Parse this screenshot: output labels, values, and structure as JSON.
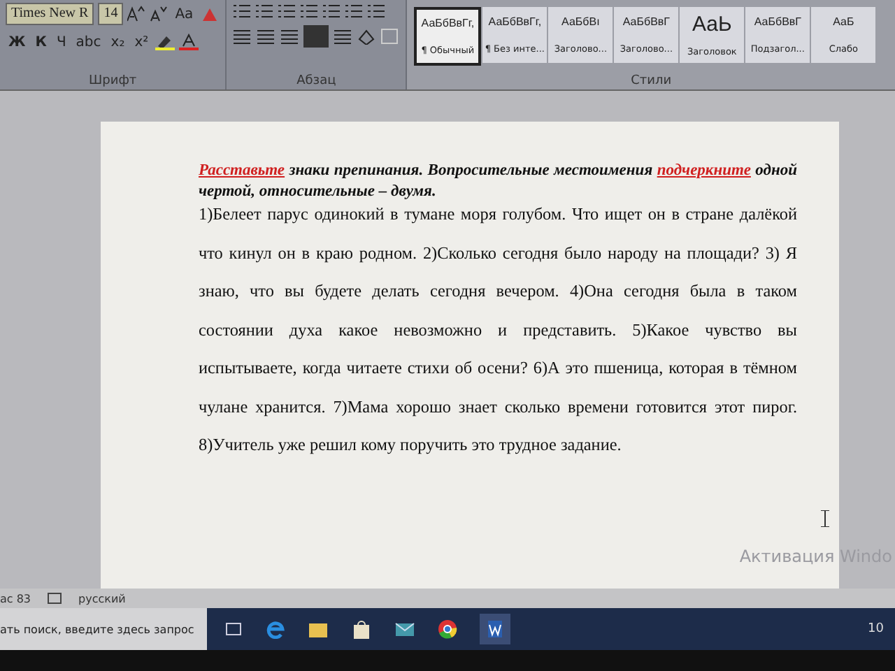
{
  "ribbon": {
    "font": {
      "name": "Times New R",
      "size": "14",
      "case_button": "Aa",
      "format_buttons": [
        "Ж",
        "К",
        "Ч",
        "abc",
        "x₂",
        "x²"
      ],
      "label": "Шрифт"
    },
    "paragraph": {
      "label": "Абзац"
    },
    "styles": {
      "label": "Стили",
      "items": [
        {
          "sample": "АаБбВвГг,",
          "name": "¶ Обычный",
          "selected": true
        },
        {
          "sample": "АаБбВвГг,",
          "name": "¶ Без инте...",
          "selected": false
        },
        {
          "sample": "АаБбВı",
          "name": "Заголово...",
          "selected": false
        },
        {
          "sample": "АаБбВвГ",
          "name": "Заголово...",
          "selected": false
        },
        {
          "sample": "АаЬ",
          "name": "Заголовок",
          "selected": false
        },
        {
          "sample": "АаБбВвГ",
          "name": "Подзагол...",
          "selected": false
        },
        {
          "sample": "АаБ",
          "name": "Слабо",
          "selected": false
        }
      ]
    }
  },
  "document": {
    "instruction": [
      {
        "kind": "marked",
        "text": "Расставьте"
      },
      {
        "kind": "plain",
        "text": " знаки препинания. Вопросительные местоимения "
      },
      {
        "kind": "marked",
        "text": "подчеркните"
      },
      {
        "kind": "plain",
        "text": " одной чертой, относительные – двумя."
      }
    ],
    "body": "1)Белеет парус одинокий в тумане моря голубом. Что ищет он в стране далёкой что кинул он в краю родном. 2)Сколько сегодня было народу на площади? 3) Я знаю, что вы будете делать сегодня вечером. 4)Она сегодня была в таком состоянии духа какое невозможно и представить. 5)Какое чувство вы испытываете, когда читаете стихи об осени? 6)А это пшеница, которая в тёмном чулане хранится.  7)Мама хорошо знает сколько времени готовится этот пирог. 8)Учитель уже решил кому поручить это трудное задание."
  },
  "activation_notice": "Активация Windo",
  "status_bar": {
    "words": "ас 83",
    "language": "русский"
  },
  "taskbar": {
    "search_placeholder": "ать поиск, введите здесь запрос",
    "clock": "10"
  }
}
